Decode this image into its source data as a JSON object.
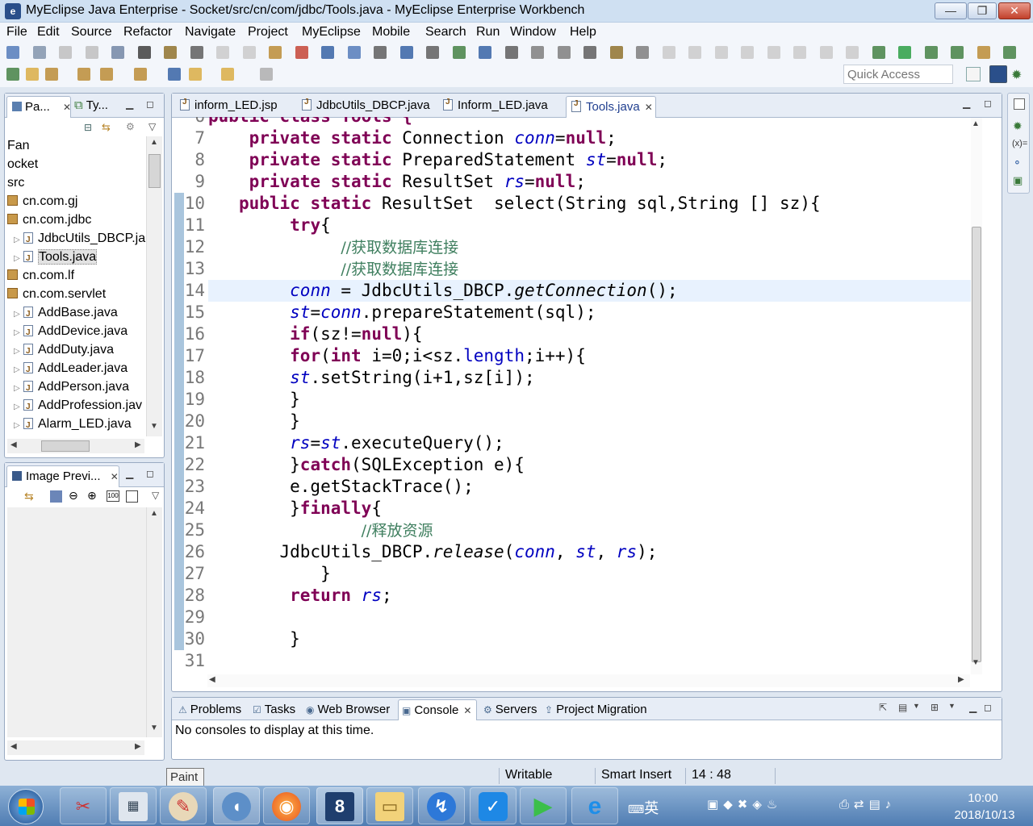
{
  "window": {
    "title": "MyEclipse Java Enterprise - Socket/src/cn/com/jdbc/Tools.java - MyEclipse Enterprise Workbench",
    "minimize": "—",
    "maximize": "❐",
    "close": "✕"
  },
  "menu": [
    "File",
    "Edit",
    "Source",
    "Refactor",
    "Navigate",
    "Project",
    "MyEclipse",
    "Mobile",
    "Search",
    "Run",
    "Window",
    "Help"
  ],
  "quick_access": {
    "placeholder": "Quick Access"
  },
  "explorer": {
    "tabs": [
      "Pa...",
      "Ty..."
    ],
    "items": [
      {
        "label": "Fan",
        "kind": "project",
        "indent": 0
      },
      {
        "label": "ocket",
        "kind": "project",
        "indent": 0
      },
      {
        "label": "src",
        "kind": "folder",
        "indent": 0
      },
      {
        "label": "cn.com.gj",
        "kind": "package",
        "indent": 0
      },
      {
        "label": "cn.com.jdbc",
        "kind": "package",
        "indent": 0
      },
      {
        "label": "JdbcUtils_DBCP.ja",
        "kind": "java",
        "indent": 1
      },
      {
        "label": "Tools.java",
        "kind": "java",
        "indent": 1,
        "selected": true
      },
      {
        "label": "cn.com.lf",
        "kind": "package",
        "indent": 0
      },
      {
        "label": "cn.com.servlet",
        "kind": "package",
        "indent": 0
      },
      {
        "label": "AddBase.java",
        "kind": "java",
        "indent": 1
      },
      {
        "label": "AddDevice.java",
        "kind": "java",
        "indent": 1
      },
      {
        "label": "AddDuty.java",
        "kind": "java",
        "indent": 1
      },
      {
        "label": "AddLeader.java",
        "kind": "java",
        "indent": 1
      },
      {
        "label": "AddPerson.java",
        "kind": "java",
        "indent": 1
      },
      {
        "label": "AddProfession.jav",
        "kind": "java",
        "indent": 1
      },
      {
        "label": "Alarm_LED.java",
        "kind": "java",
        "indent": 1
      }
    ]
  },
  "image_preview": {
    "title": "Image Previ..."
  },
  "editor": {
    "tabs": [
      {
        "label": "inform_LED.jsp",
        "active": false
      },
      {
        "label": "JdbcUtils_DBCP.java",
        "active": false
      },
      {
        "label": "Inform_LED.java",
        "active": false
      },
      {
        "label": "Tools.java",
        "active": true
      }
    ],
    "partial_top": "public class Tools {",
    "lines": [
      {
        "n": "7",
        "text": "    private static Connection conn=null;"
      },
      {
        "n": "8",
        "text": "    private static PreparedStatement st=null;"
      },
      {
        "n": "9",
        "text": "    private static ResultSet rs=null;"
      },
      {
        "n": "10",
        "text": "   public static ResultSet  select(String sql,String [] sz){"
      },
      {
        "n": "11",
        "text": "        try{"
      },
      {
        "n": "12",
        "text": "             //获取数据库连接"
      },
      {
        "n": "13",
        "text": "             //获取数据库连接"
      },
      {
        "n": "14",
        "text": "        conn = JdbcUtils_DBCP.getConnection();",
        "current": true
      },
      {
        "n": "15",
        "text": "        st=conn.prepareStatement(sql);"
      },
      {
        "n": "16",
        "text": "        if(sz!=null){"
      },
      {
        "n": "17",
        "text": "        for(int i=0;i<sz.length;i++){"
      },
      {
        "n": "18",
        "text": "        st.setString(i+1,sz[i]);"
      },
      {
        "n": "19",
        "text": "        }"
      },
      {
        "n": "20",
        "text": "        }"
      },
      {
        "n": "21",
        "text": "        rs=st.executeQuery();"
      },
      {
        "n": "22",
        "text": "        }catch(SQLException e){"
      },
      {
        "n": "23",
        "text": "        e.getStackTrace();"
      },
      {
        "n": "24",
        "text": "        }finally{"
      },
      {
        "n": "25",
        "text": "               //释放资源"
      },
      {
        "n": "26",
        "text": "       JdbcUtils_DBCP.release(conn, st, rs);"
      },
      {
        "n": "27",
        "text": "           }"
      },
      {
        "n": "28",
        "text": "        return rs;"
      },
      {
        "n": "29",
        "text": ""
      },
      {
        "n": "30",
        "text": "        }"
      },
      {
        "n": "31",
        "text": ""
      }
    ]
  },
  "bottom": {
    "tabs": [
      {
        "label": "Problems",
        "active": false
      },
      {
        "label": "Tasks",
        "active": false
      },
      {
        "label": "Web Browser",
        "active": false
      },
      {
        "label": "Console",
        "active": true
      },
      {
        "label": "Servers",
        "active": false
      },
      {
        "label": "Project Migration",
        "active": false
      }
    ],
    "console_message": "No consoles to display at this time."
  },
  "status": {
    "writable": "Writable",
    "insert_mode": "Smart Insert",
    "position": "14 : 48"
  },
  "taskbar": {
    "tooltip": "Paint",
    "ime_label": "英",
    "clock_time": "10:00",
    "clock_date": "2018/10/13"
  },
  "colors": {
    "keyword": "#7f0055",
    "field": "#0000c0",
    "comment": "#3f7f5f",
    "current_line": "#e8f2fe"
  }
}
